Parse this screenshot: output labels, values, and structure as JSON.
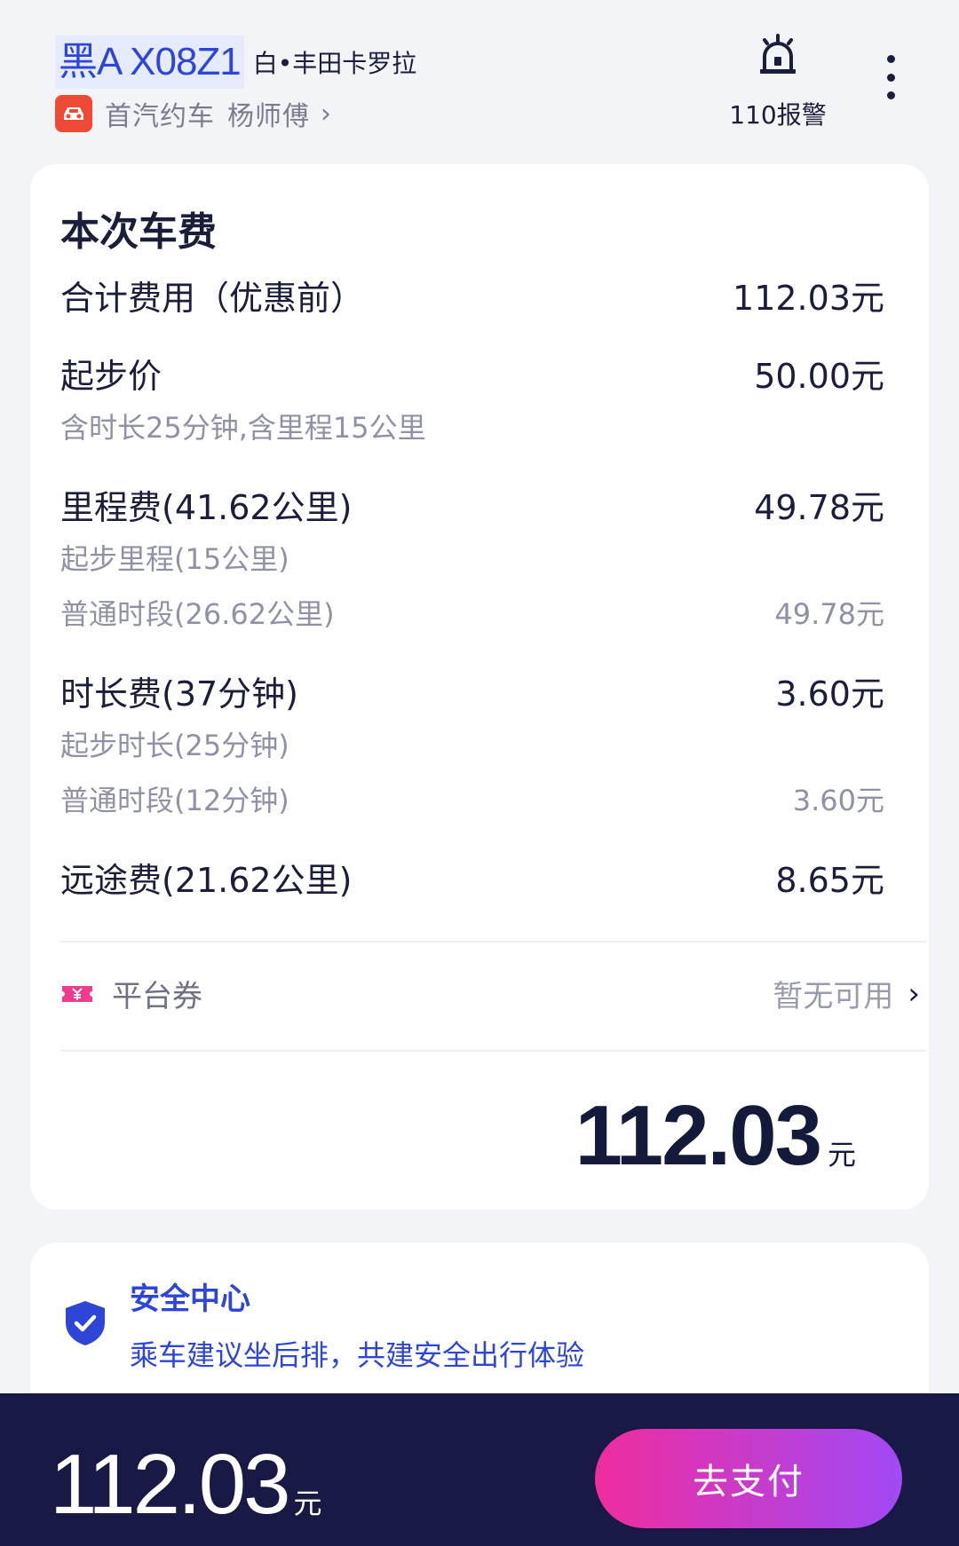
{
  "header": {
    "plate": "黑A X08Z1",
    "car_desc": "白•丰田卡罗拉",
    "company": "首汽约车",
    "driver": "杨师傅",
    "chevron": "›",
    "police_label": "110报警"
  },
  "fee": {
    "title": "本次车费",
    "total_pre_label": "合计费用（优惠前）",
    "total_pre_value": "112.03元",
    "base_label": "起步价",
    "base_value": "50.00元",
    "base_note": "含时长25分钟,含里程15公里",
    "mileage_label": "里程费(41.62公里)",
    "mileage_value": "49.78元",
    "mileage_start_label": "起步里程(15公里)",
    "mileage_normal_label": "普通时段(26.62公里)",
    "mileage_normal_value": "49.78元",
    "duration_label": "时长费(37分钟)",
    "duration_value": "3.60元",
    "duration_start_label": "起步时长(25分钟)",
    "duration_normal_label": "普通时段(12分钟)",
    "duration_normal_value": "3.60元",
    "long_label": "远途费(21.62公里)",
    "long_value": "8.65元",
    "coupon_label": "平台券",
    "coupon_status": "暂无可用",
    "coupon_chevron": "›",
    "total_amount": "112.03",
    "total_unit": "元"
  },
  "safety": {
    "title": "安全中心",
    "text": "乘车建议坐后排，共建安全出行体验"
  },
  "bottom": {
    "amount": "112.03",
    "unit": "元",
    "pay_label": "去支付"
  },
  "colors": {
    "accent_blue": "#2e46d8",
    "pay_gradient_start": "#f02c9e",
    "pay_gradient_end": "#a14af5",
    "bottom_bar": "#181a45"
  },
  "icons": [
    "car-logo-icon",
    "police-alarm-icon",
    "more-icon",
    "coupon-ticket-icon",
    "shield-check-icon"
  ]
}
